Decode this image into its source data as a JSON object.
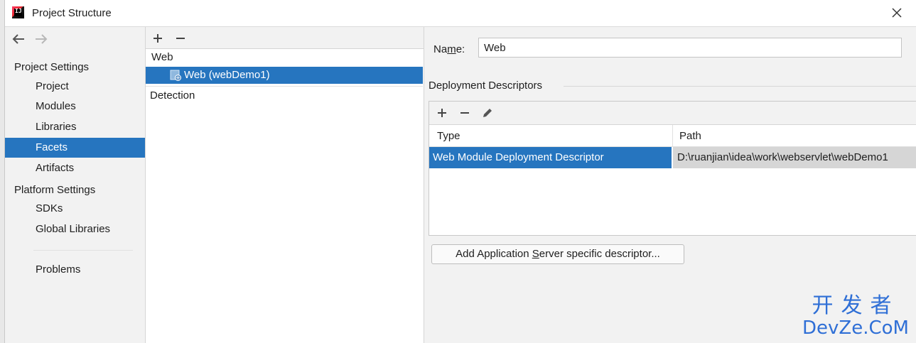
{
  "window": {
    "title": "Project Structure"
  },
  "nav": {
    "project_settings_header": "Project Settings",
    "platform_settings_header": "Platform Settings",
    "items": {
      "project": "Project",
      "modules": "Modules",
      "libraries": "Libraries",
      "facets": "Facets",
      "artifacts": "Artifacts",
      "sdks": "SDKs",
      "global_libraries": "Global Libraries",
      "problems": "Problems"
    },
    "selected": "Facets"
  },
  "tree": {
    "group": "Web",
    "node": "Web (webDemo1)",
    "detection": "Detection",
    "toolbar": {
      "add": "+",
      "remove": "−"
    }
  },
  "detail": {
    "name_label_pre": "Na",
    "name_label_mnemonic": "m",
    "name_label_post": "e:",
    "name_value": "Web",
    "deployment_descriptors_title": "Deployment Descriptors",
    "table": {
      "columns": [
        "Type",
        "Path"
      ],
      "rows": [
        {
          "type": "Web Module Deployment Descriptor",
          "path": "D:\\ruanjian\\idea\\work\\webservlet\\webDemo1"
        }
      ]
    },
    "add_server_btn_pre": "Add Application ",
    "add_server_btn_mnemonic": "S",
    "add_server_btn_post": "erver specific descriptor..."
  },
  "watermark": {
    "cn": "开发者",
    "en": "DevZe.CoM"
  },
  "colors": {
    "selection": "#2675bf",
    "panel": "#f2f2f2",
    "watermark": "#2f6fd6"
  }
}
